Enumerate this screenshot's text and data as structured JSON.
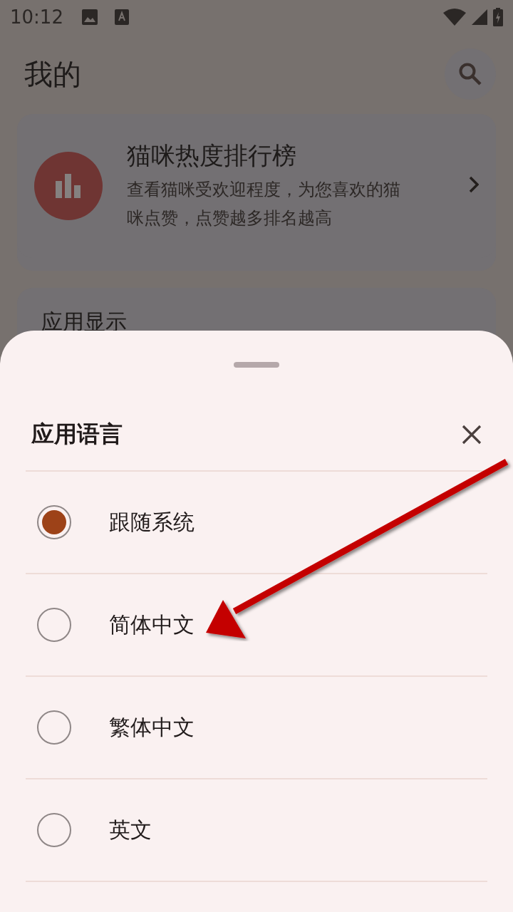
{
  "status_bar": {
    "time": "10:12"
  },
  "header": {
    "title": "我的"
  },
  "ranking_card": {
    "title": "猫咪热度排行榜",
    "description": "查看猫咪受欢迎程度，为您喜欢的猫咪点赞，点赞越多排名越高"
  },
  "settings_card": {
    "title": "应用显示"
  },
  "language_sheet": {
    "title": "应用语言",
    "options": [
      {
        "label": "跟随系统",
        "selected": true
      },
      {
        "label": "简体中文",
        "selected": false
      },
      {
        "label": "繁体中文",
        "selected": false
      },
      {
        "label": "英文",
        "selected": false
      }
    ]
  },
  "annotation": {
    "kind": "arrow"
  }
}
